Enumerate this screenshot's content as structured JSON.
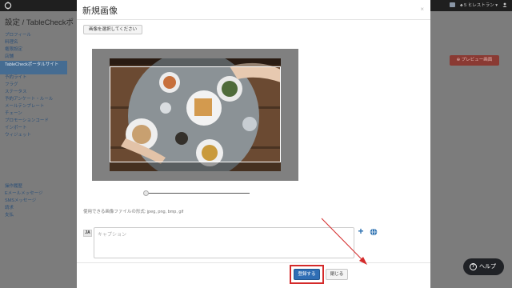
{
  "app": {
    "page_title": "設定 / TableCheckポ",
    "top_user": "♣ 5 ヒレストラン ▾",
    "preview_label": "⊕ プレビュー画面",
    "help_label": "ヘルプ"
  },
  "sidebar": {
    "items": [
      {
        "label": "プロフィール"
      },
      {
        "label": "料理名"
      },
      {
        "label": "権限設定"
      },
      {
        "label": "店舗"
      },
      {
        "label": "TableCheckポータルサイト",
        "active": true
      },
      {
        "label": "予約ライト"
      },
      {
        "label": "フラグ"
      },
      {
        "label": "ステータス"
      },
      {
        "label": "予約アンケート・ルール"
      },
      {
        "label": "メールテンプレート"
      },
      {
        "label": "チェーン"
      },
      {
        "label": "プロモーションコード"
      },
      {
        "label": "インポート"
      },
      {
        "label": "ウィジェット"
      }
    ],
    "items2": [
      {
        "label": "操作履歴"
      },
      {
        "label": "Eメールメッセージ"
      },
      {
        "label": "SMSメッセージ"
      },
      {
        "label": "請求"
      },
      {
        "label": "支払"
      }
    ]
  },
  "modal": {
    "title": "新規画像",
    "close_glyph": "×",
    "select_image_label": "画像を選択してください",
    "formats_text": "使用できる画像ファイルの形式: jpeg, png, bmp, gif",
    "lang_code": "JA",
    "caption_placeholder": "キャプション",
    "caption_value": "",
    "zoom_level": 0.0,
    "register_label": "登録する",
    "close_label": "閉じる"
  },
  "icons": {
    "add": "plus-icon",
    "translate": "globe-icon",
    "help": "question-icon"
  },
  "colors": {
    "primary": "#2f6eb5",
    "highlight": "#d42a2a",
    "preview": "#8a3a33"
  }
}
